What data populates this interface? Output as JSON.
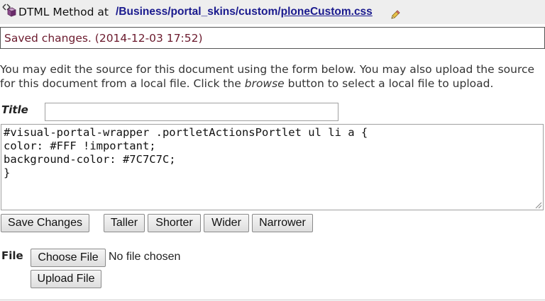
{
  "header": {
    "icon": "dtml-method-icon",
    "label": "DTML Method at",
    "breadcrumb": [
      {
        "text": "/Business"
      },
      {
        "text": "/portal_skins"
      },
      {
        "text": "/custom"
      },
      {
        "text": "/"
      },
      {
        "text": "ploneCustom.css"
      }
    ],
    "edit_icon": "pencil-icon"
  },
  "status": {
    "message": "Saved changes. (2014-12-03 17:52)",
    "color": "#6b1a2d"
  },
  "instructions": {
    "part1": "You may edit the source for this document using the form below. You may also upload the source for this document from a local file. Click the ",
    "emphasis": "browse",
    "part2": " button to select a local file to upload."
  },
  "form": {
    "title_label": "Title",
    "title_value": "",
    "source": "#visual-portal-wrapper .portletActionsPortlet ul li a {\ncolor: #FFF !important;\nbackground-color: #7C7C7C;\n}",
    "buttons": {
      "save": "Save Changes",
      "taller": "Taller",
      "shorter": "Shorter",
      "wider": "Wider",
      "narrower": "Narrower"
    }
  },
  "upload": {
    "file_label": "File",
    "choose_button": "Choose File",
    "no_file_text": "No file chosen",
    "upload_button": "Upload File"
  }
}
